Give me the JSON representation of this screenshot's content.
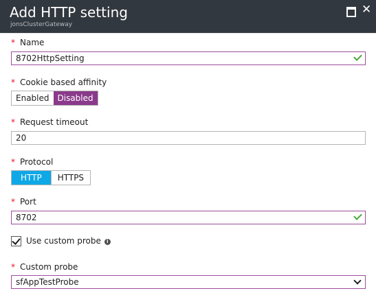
{
  "header": {
    "title": "Add HTTP setting",
    "subtitle": "jonsClusterGateway",
    "close_glyph": "✕"
  },
  "fields": {
    "required_mark": "*",
    "name": {
      "label": "Name",
      "value": "8702HttpSetting",
      "valid": true
    },
    "cookie_affinity": {
      "label": "Cookie based affinity",
      "options": [
        "Enabled",
        "Disabled"
      ],
      "selected": "Disabled"
    },
    "request_timeout": {
      "label": "Request timeout",
      "value": "20"
    },
    "protocol": {
      "label": "Protocol",
      "options": [
        "HTTP",
        "HTTPS"
      ],
      "selected": "HTTP"
    },
    "port": {
      "label": "Port",
      "value": "8702",
      "valid": true
    },
    "use_custom_probe": {
      "label": "Use custom probe",
      "checked": true,
      "info_glyph": "i"
    },
    "custom_probe": {
      "label": "Custom probe",
      "value": "sfAppTestProbe"
    }
  },
  "colors": {
    "header_bg": "#32383f",
    "accent_purple": "#8a3a8a",
    "accent_blue": "#0fa8e6",
    "required": "#e81123",
    "valid_check": "#4aa83c"
  },
  "icons": [
    "maximize-icon",
    "close-icon",
    "check-icon",
    "info-icon",
    "chevron-down-icon"
  ]
}
